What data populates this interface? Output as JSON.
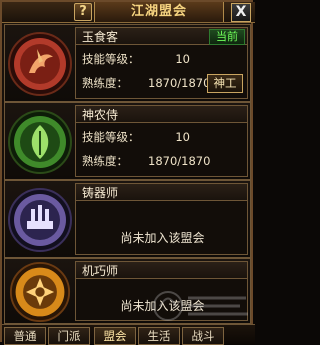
{
  "window": {
    "title": "江湖盟会",
    "help_label": "?",
    "close_label": "X"
  },
  "cards": [
    {
      "name": "玉食客",
      "status": "当前",
      "skill_label": "技能等级：",
      "skill_value": "10",
      "prof_label": "熟练度：",
      "prof_value": "1870/1870",
      "action": "神工",
      "emblem_icon": "dragon-emblem-icon",
      "emblem_color": "#b23a2a"
    },
    {
      "name": "神农侍",
      "skill_label": "技能等级：",
      "skill_value": "10",
      "prof_label": "熟练度：",
      "prof_value": "1870/1870",
      "emblem_icon": "herb-emblem-icon",
      "emblem_color": "#3f8a2a"
    },
    {
      "name": "铸器师",
      "not_joined": "尚未加入该盟会",
      "emblem_icon": "forge-emblem-icon",
      "emblem_color": "#6a5aa0"
    },
    {
      "name": "机巧师",
      "not_joined": "尚未加入该盟会",
      "emblem_icon": "gear-emblem-icon",
      "emblem_color": "#d88a1a"
    }
  ],
  "tabs": [
    {
      "label": "普通"
    },
    {
      "label": "门派"
    },
    {
      "label": "盟会"
    },
    {
      "label": "生活"
    },
    {
      "label": "战斗"
    }
  ]
}
